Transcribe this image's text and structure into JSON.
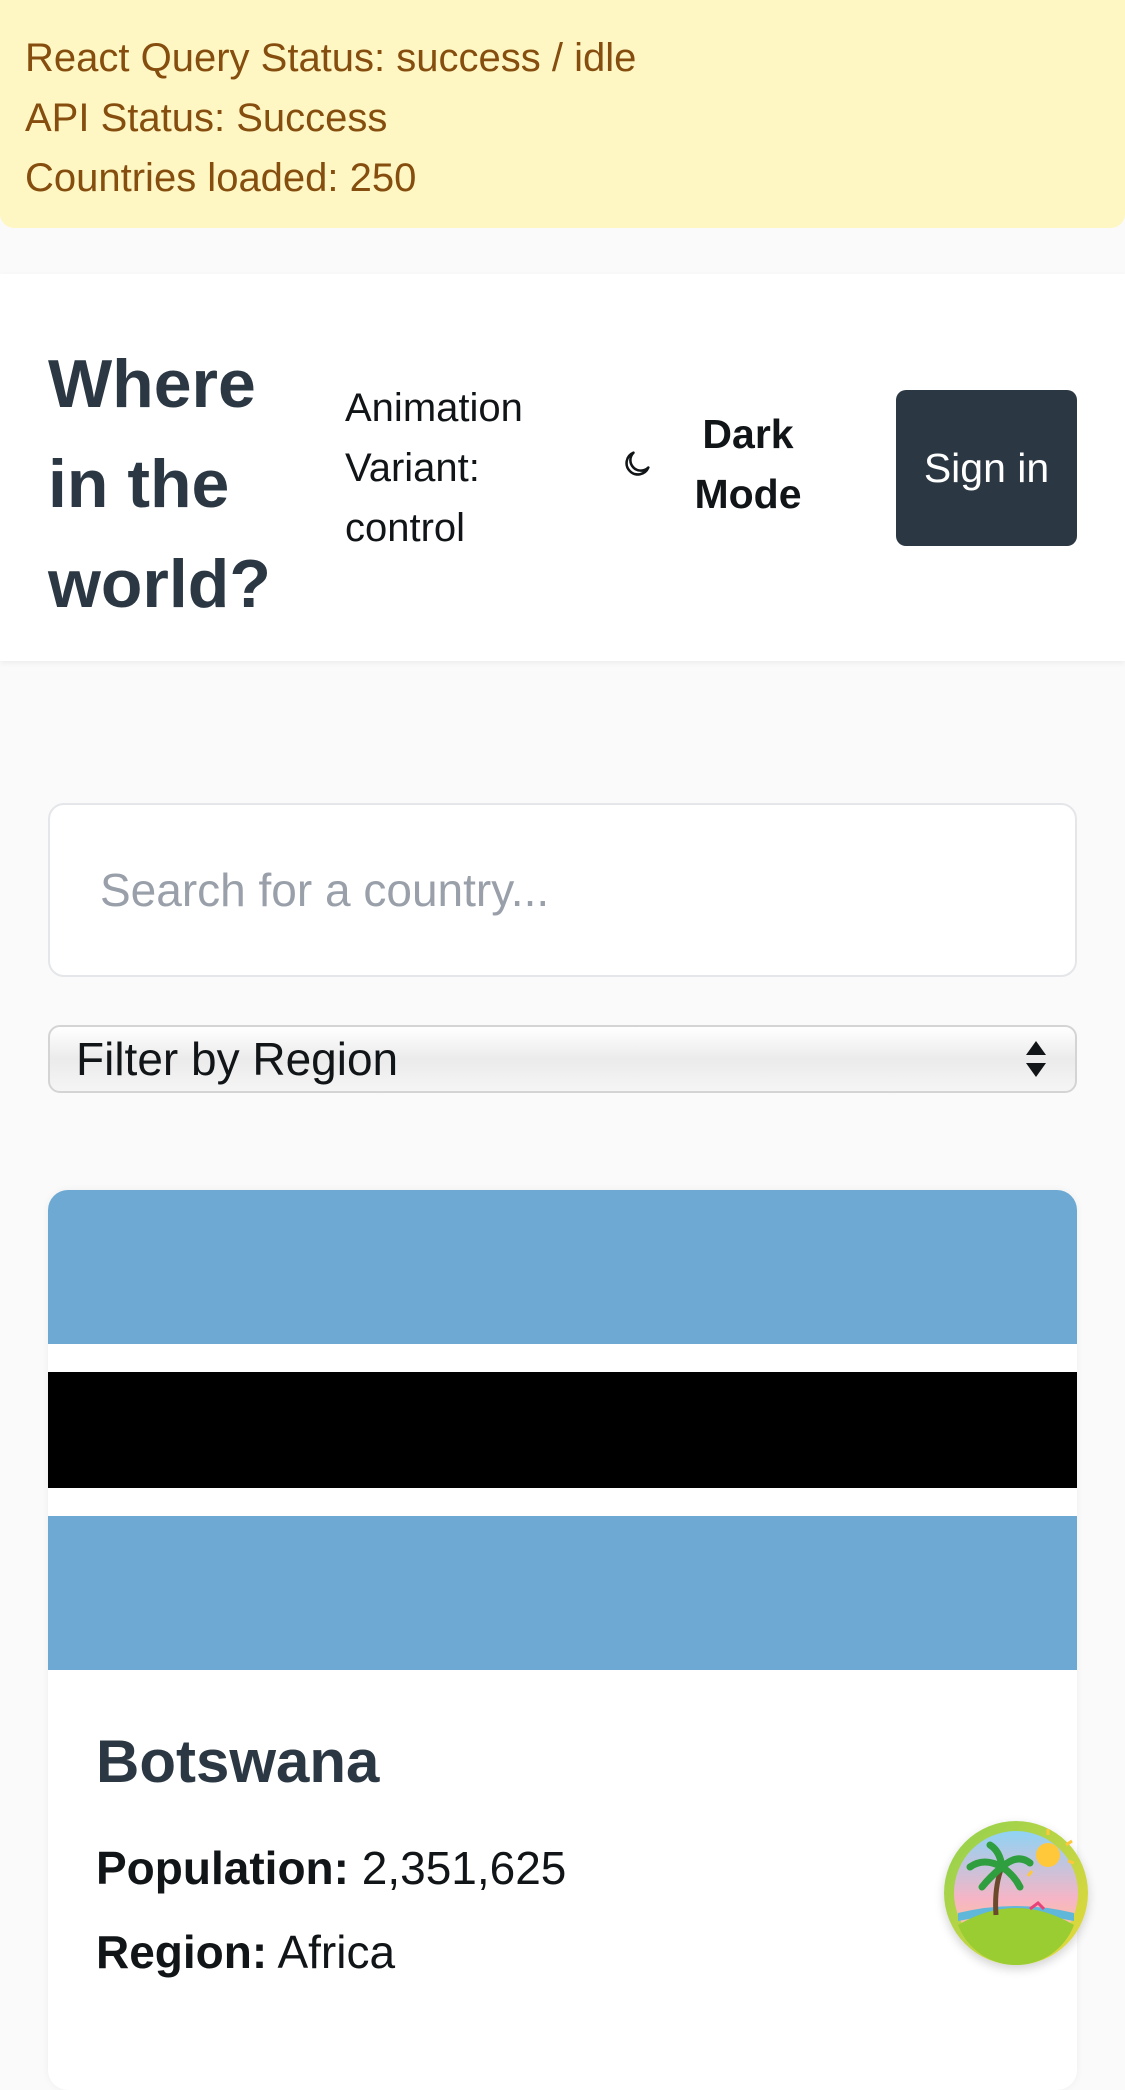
{
  "debug": {
    "query_status": "React Query Status: success / idle",
    "api_status": "API Status: Success",
    "countries_loaded": "Countries loaded: 250"
  },
  "header": {
    "logo": "Where in the world?",
    "variant": "Animation Variant: control",
    "dark_mode_label": "Dark Mode",
    "sign_in_label": "Sign in",
    "icons": {
      "theme": "moon-icon"
    }
  },
  "search": {
    "placeholder": "Search for a country..."
  },
  "filter": {
    "selected": "Filter by Region"
  },
  "countries": [
    {
      "name": "Botswana",
      "population_label": "Population:",
      "population": "2,351,625",
      "region_label": "Region:",
      "region": "Africa",
      "flag_colors": {
        "blue": "#6da9d2",
        "white": "#ffffff",
        "black": "#000000"
      }
    }
  ],
  "colors": {
    "banner_bg": "#fef7c3",
    "banner_text": "#854d0e",
    "primary_dark": "#2b3844"
  },
  "fab": {
    "icon": "island-icon"
  }
}
